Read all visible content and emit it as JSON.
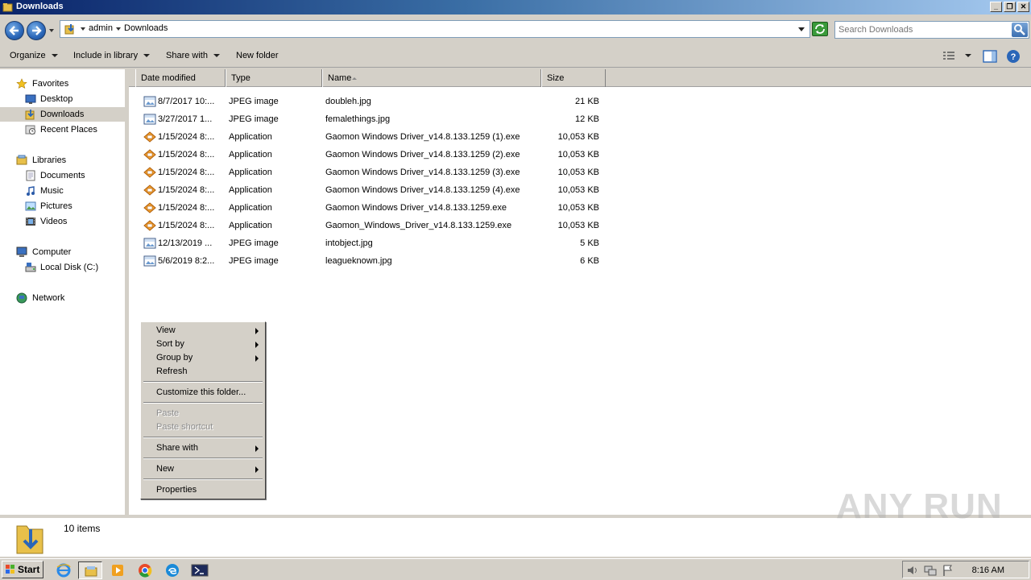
{
  "window": {
    "title": "Downloads"
  },
  "address": {
    "segments": [
      "admin",
      "Downloads"
    ]
  },
  "search": {
    "placeholder": "Search Downloads"
  },
  "toolbar": {
    "organize": "Organize",
    "include_in_library": "Include in library",
    "share_with": "Share with",
    "new_folder": "New folder"
  },
  "nav": {
    "favorites": "Favorites",
    "desktop": "Desktop",
    "downloads": "Downloads",
    "recent_places": "Recent Places",
    "libraries": "Libraries",
    "documents": "Documents",
    "music": "Music",
    "pictures": "Pictures",
    "videos": "Videos",
    "computer": "Computer",
    "local_disk": "Local Disk (C:)",
    "network": "Network"
  },
  "columns": {
    "date": "Date modified",
    "type": "Type",
    "name": "Name",
    "size": "Size"
  },
  "files": [
    {
      "date": "8/7/2017 10:...",
      "type": "JPEG image",
      "name": "doubleh.jpg",
      "size": "21 KB",
      "icon": "image-file-icon"
    },
    {
      "date": "3/27/2017 1...",
      "type": "JPEG image",
      "name": "femalethings.jpg",
      "size": "12 KB",
      "icon": "image-file-icon"
    },
    {
      "date": "1/15/2024 8:...",
      "type": "Application",
      "name": "Gaomon Windows Driver_v14.8.133.1259 (1).exe",
      "size": "10,053 KB",
      "icon": "installer-icon"
    },
    {
      "date": "1/15/2024 8:...",
      "type": "Application",
      "name": "Gaomon Windows Driver_v14.8.133.1259 (2).exe",
      "size": "10,053 KB",
      "icon": "installer-icon"
    },
    {
      "date": "1/15/2024 8:...",
      "type": "Application",
      "name": "Gaomon Windows Driver_v14.8.133.1259 (3).exe",
      "size": "10,053 KB",
      "icon": "installer-icon"
    },
    {
      "date": "1/15/2024 8:...",
      "type": "Application",
      "name": "Gaomon Windows Driver_v14.8.133.1259 (4).exe",
      "size": "10,053 KB",
      "icon": "installer-icon"
    },
    {
      "date": "1/15/2024 8:...",
      "type": "Application",
      "name": "Gaomon Windows Driver_v14.8.133.1259.exe",
      "size": "10,053 KB",
      "icon": "installer-icon"
    },
    {
      "date": "1/15/2024 8:...",
      "type": "Application",
      "name": "Gaomon_Windows_Driver_v14.8.133.1259.exe",
      "size": "10,053 KB",
      "icon": "installer-icon"
    },
    {
      "date": "12/13/2019 ...",
      "type": "JPEG image",
      "name": "intobject.jpg",
      "size": "5 KB",
      "icon": "image-file-icon"
    },
    {
      "date": "5/6/2019 8:2...",
      "type": "JPEG image",
      "name": "leagueknown.jpg",
      "size": "6 KB",
      "icon": "image-file-icon"
    }
  ],
  "context_menu": {
    "view": "View",
    "sort_by": "Sort by",
    "group_by": "Group by",
    "refresh": "Refresh",
    "customize": "Customize this folder...",
    "paste": "Paste",
    "paste_shortcut": "Paste shortcut",
    "share_with": "Share with",
    "new": "New",
    "properties": "Properties"
  },
  "details": {
    "item_count": "10 items"
  },
  "taskbar": {
    "start": "Start",
    "clock": "8:16 AM"
  },
  "watermark": "ANY RUN",
  "colors": {
    "title_start": "#0a246a",
    "title_end": "#a6caf0",
    "chrome": "#d4d0c8"
  }
}
